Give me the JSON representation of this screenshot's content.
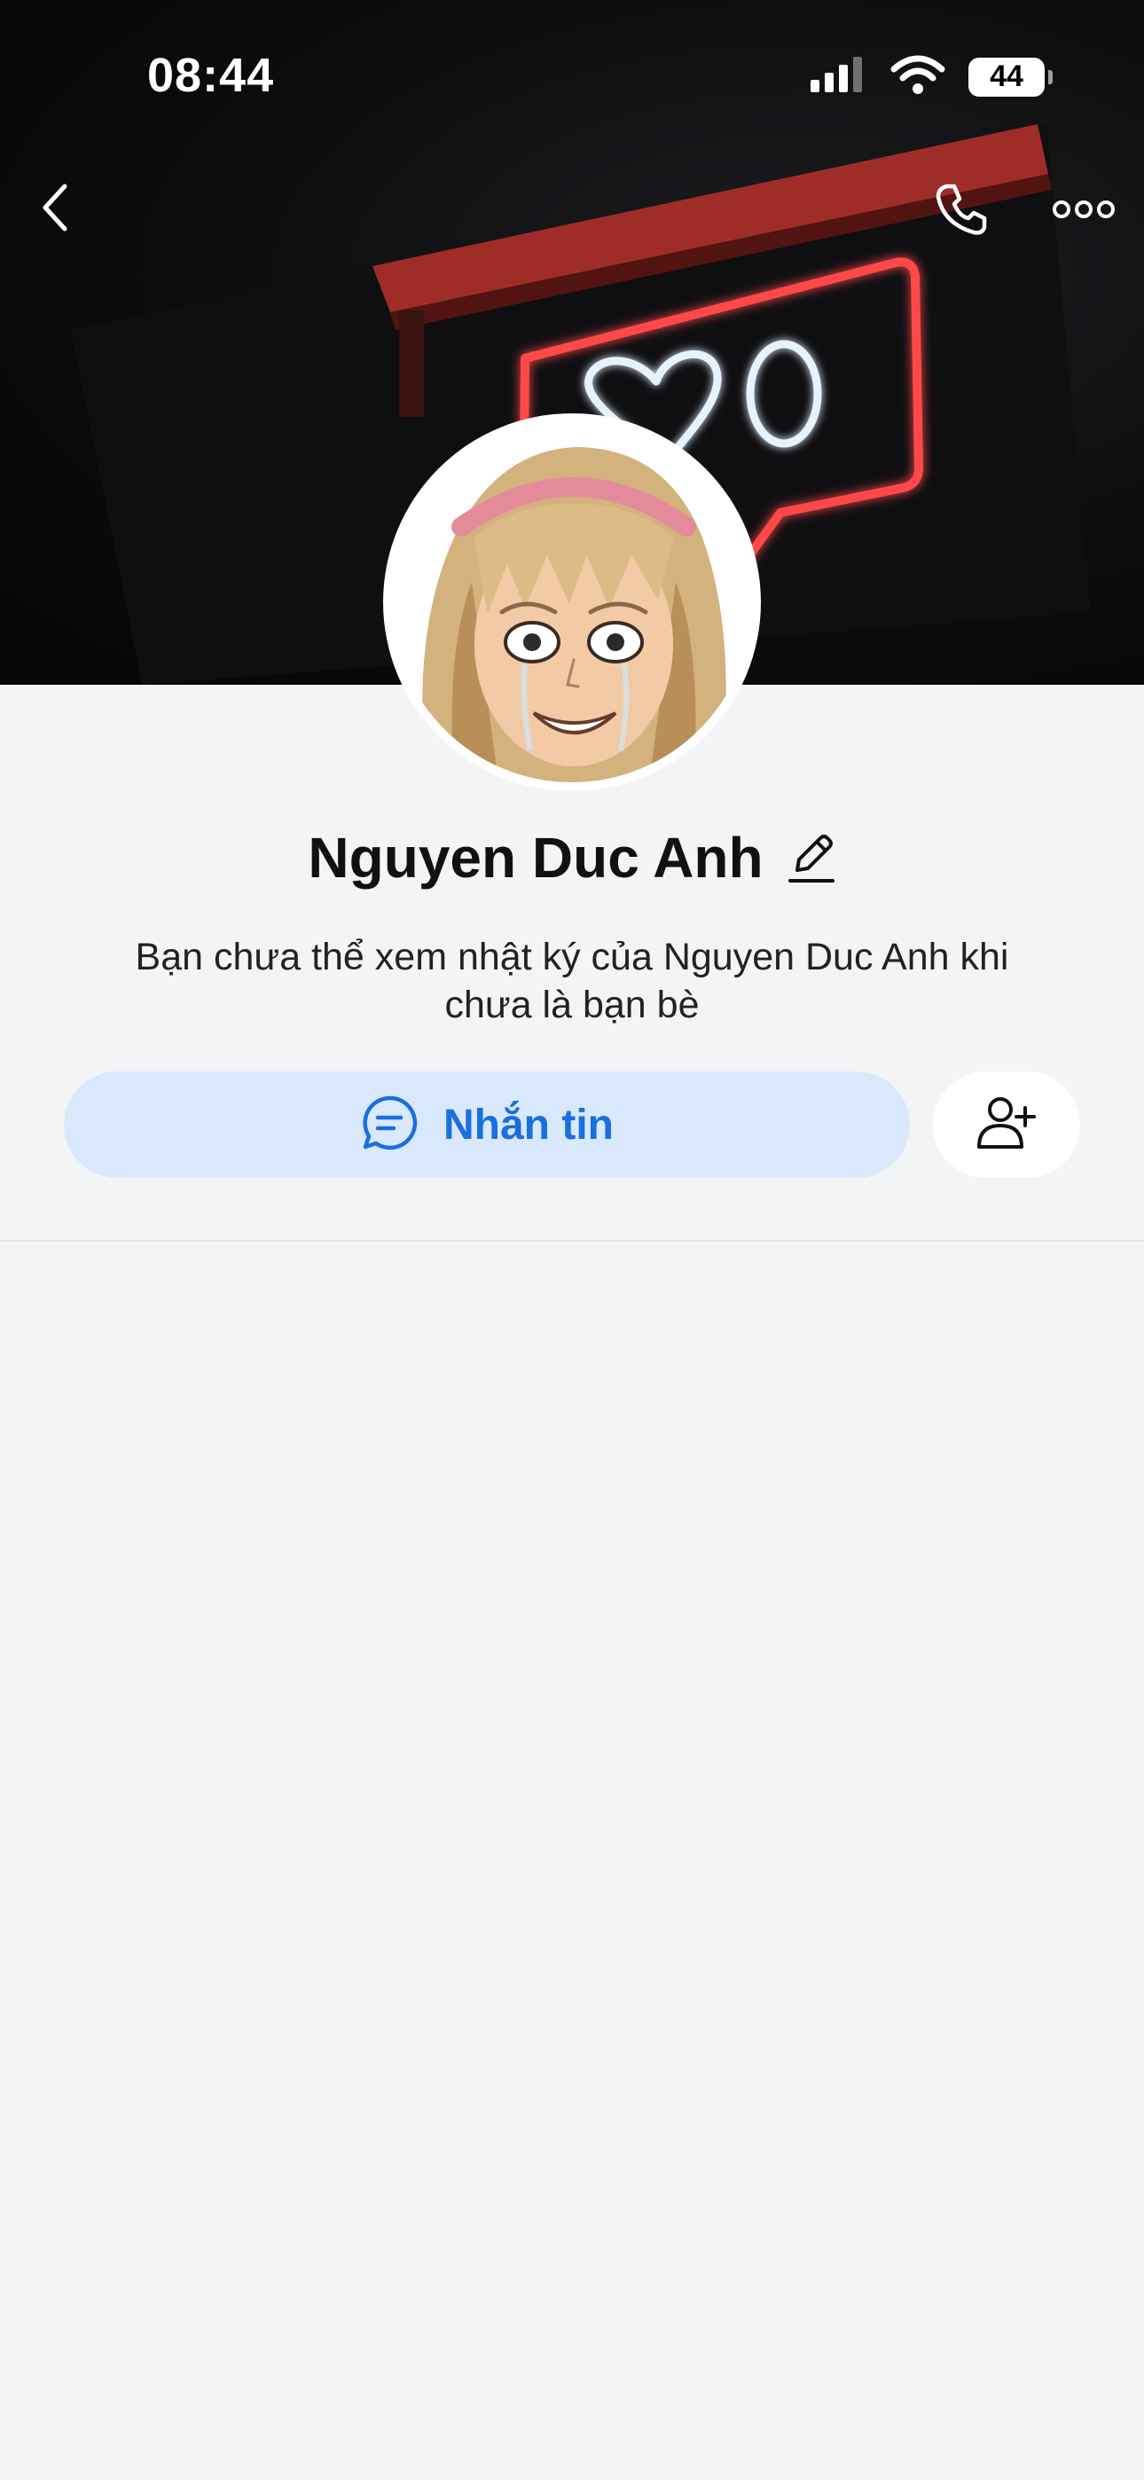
{
  "status_bar": {
    "time": "08:44",
    "battery_level": "44",
    "signal_icon": "cellular-signal-icon",
    "wifi_icon": "wifi-icon"
  },
  "nav": {
    "back_icon": "chevron-left-icon",
    "call_icon": "phone-icon",
    "more_icon": "more-horizontal-icon"
  },
  "profile": {
    "name": "Nguyen Duc Anh",
    "edit_icon": "pencil-icon",
    "privacy_note": "Bạn chưa thể xem nhật ký của Nguyen Duc Anh khi chưa là bạn bè"
  },
  "actions": {
    "message_label": "Nhắn tin",
    "message_icon": "chat-bubble-icon",
    "add_friend_icon": "add-user-icon"
  },
  "colors": {
    "accent": "#1a6fe0",
    "message_button_bg": "#d9e8fc",
    "page_bg": "#f3f4f6"
  }
}
